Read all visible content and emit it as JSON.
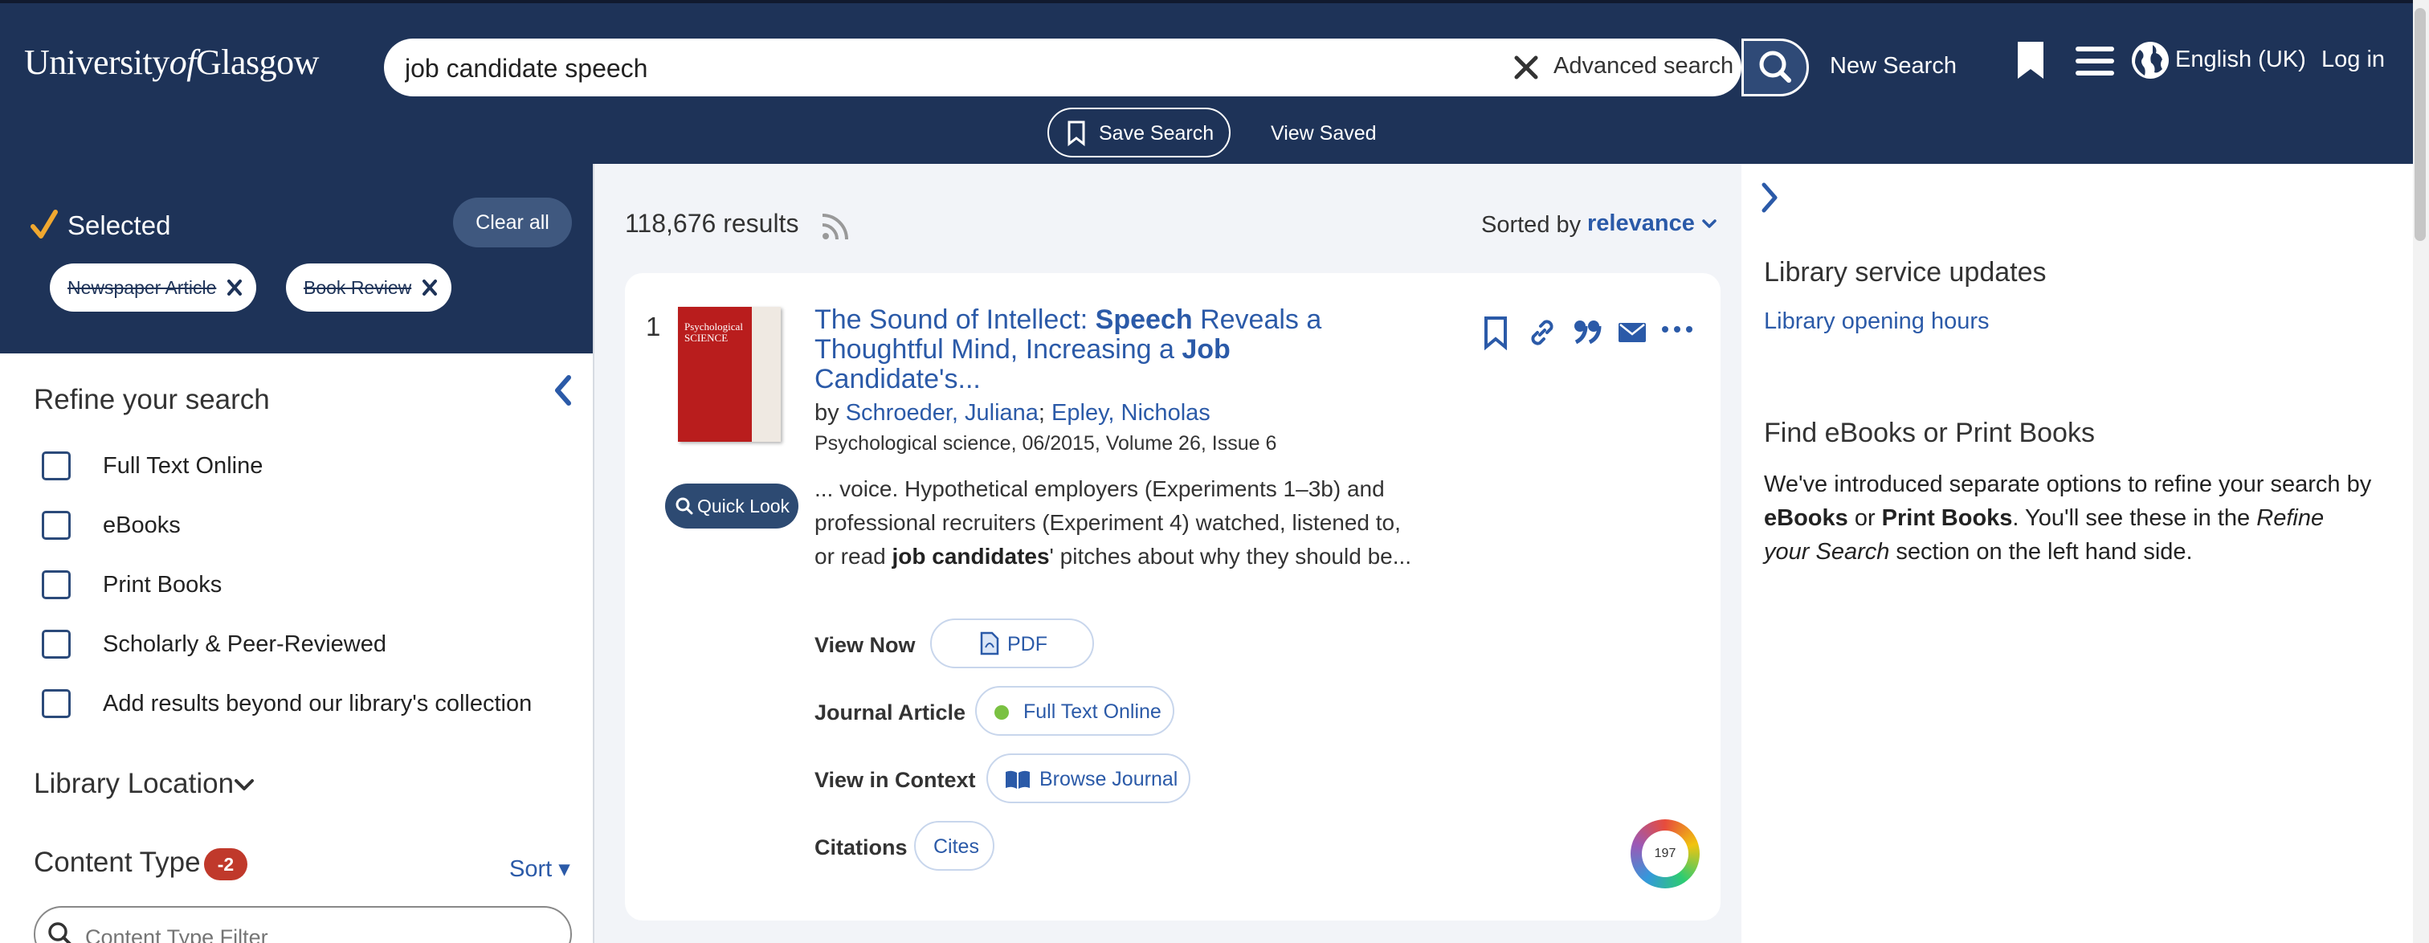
{
  "header": {
    "logo_part1": "University",
    "logo_part2": "of",
    "logo_part3": "Glasgow",
    "search_value": "job candidate speech",
    "advanced_search": "Advanced search",
    "new_search": "New Search",
    "language": "English (UK)",
    "login": "Log in",
    "save_search": "Save Search",
    "view_saved": "View Saved"
  },
  "left": {
    "selected_label": "Selected",
    "clear_all": "Clear all",
    "chips": [
      "Newspaper Article",
      "Book Review"
    ],
    "refine_title": "Refine your search",
    "facets": [
      "Full Text Online",
      "eBooks",
      "Print Books",
      "Scholarly & Peer-Reviewed",
      "Add results beyond our library's collection"
    ],
    "library_location": "Library Location",
    "content_type": "Content Type",
    "content_type_badge": "-2",
    "sort": "Sort",
    "filter_placeholder": "Content Type Filter"
  },
  "results": {
    "count": "118,676 results",
    "sorted_by_label": "Sorted by",
    "sorted_by_value": "relevance"
  },
  "result1": {
    "rank": "1",
    "thumb_title": "Psychological SCIENCE",
    "quick_look": "Quick Look",
    "title_parts": [
      "The Sound of Intellect: ",
      "Speech",
      " Reveals a Thoughtful Mind, Increasing a ",
      "Job",
      " Candidate's..."
    ],
    "by": "by",
    "author1": "Schroeder, Juliana",
    "author_sep": ";",
    "author2": "Epley, Nicholas",
    "source": "Psychological science, 06/2015, Volume 26, Issue 6",
    "snippet_parts": [
      "... voice. Hypothetical employers (Experiments 1–3b) and professional recruiters (Experiment 4) watched, listened to, or read ",
      "job candidates",
      "' pitches about why they should be..."
    ],
    "view_now": "View Now",
    "pdf": "PDF",
    "journal_article": "Journal Article",
    "full_text_online": "Full Text Online",
    "view_in_context": "View in Context",
    "browse_journal": "Browse Journal",
    "citations": "Citations",
    "cites": "Cites",
    "altmetric_score": "197"
  },
  "right": {
    "updates_title": "Library service updates",
    "opening_hours": "Library opening hours",
    "find_title": "Find eBooks or Print Books",
    "find_text_1": "We've introduced separate options to refine your search by ",
    "find_bold_1": "eBooks",
    "find_text_2": " or ",
    "find_bold_2": "Print Books",
    "find_text_3": ". You'll see these in the ",
    "find_italic": "Refine your Search",
    "find_text_4": " section on the left hand side."
  },
  "colors": {
    "header_bg": "#1e3358",
    "link": "#2b5aa8",
    "badge": "#c0392b",
    "accent_check": "#f0a830",
    "available_dot": "#7ac142"
  }
}
